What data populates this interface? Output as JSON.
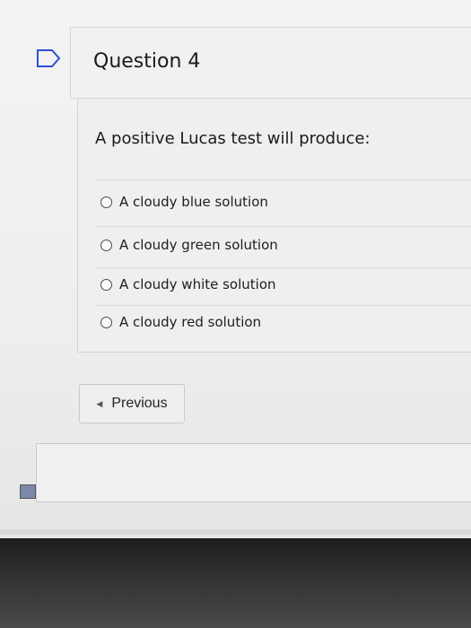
{
  "question": {
    "title": "Question 4",
    "text": "A positive Lucas test will produce:",
    "options": [
      {
        "label": "A cloudy blue solution"
      },
      {
        "label": "A cloudy green solution"
      },
      {
        "label": "A cloudy white solution"
      },
      {
        "label": "A cloudy red solution"
      }
    ]
  },
  "navigation": {
    "previous_label": "Previous",
    "previous_icon": "triangle-left-icon"
  },
  "icons": {
    "bookmark": "bookmark-flag-icon"
  }
}
